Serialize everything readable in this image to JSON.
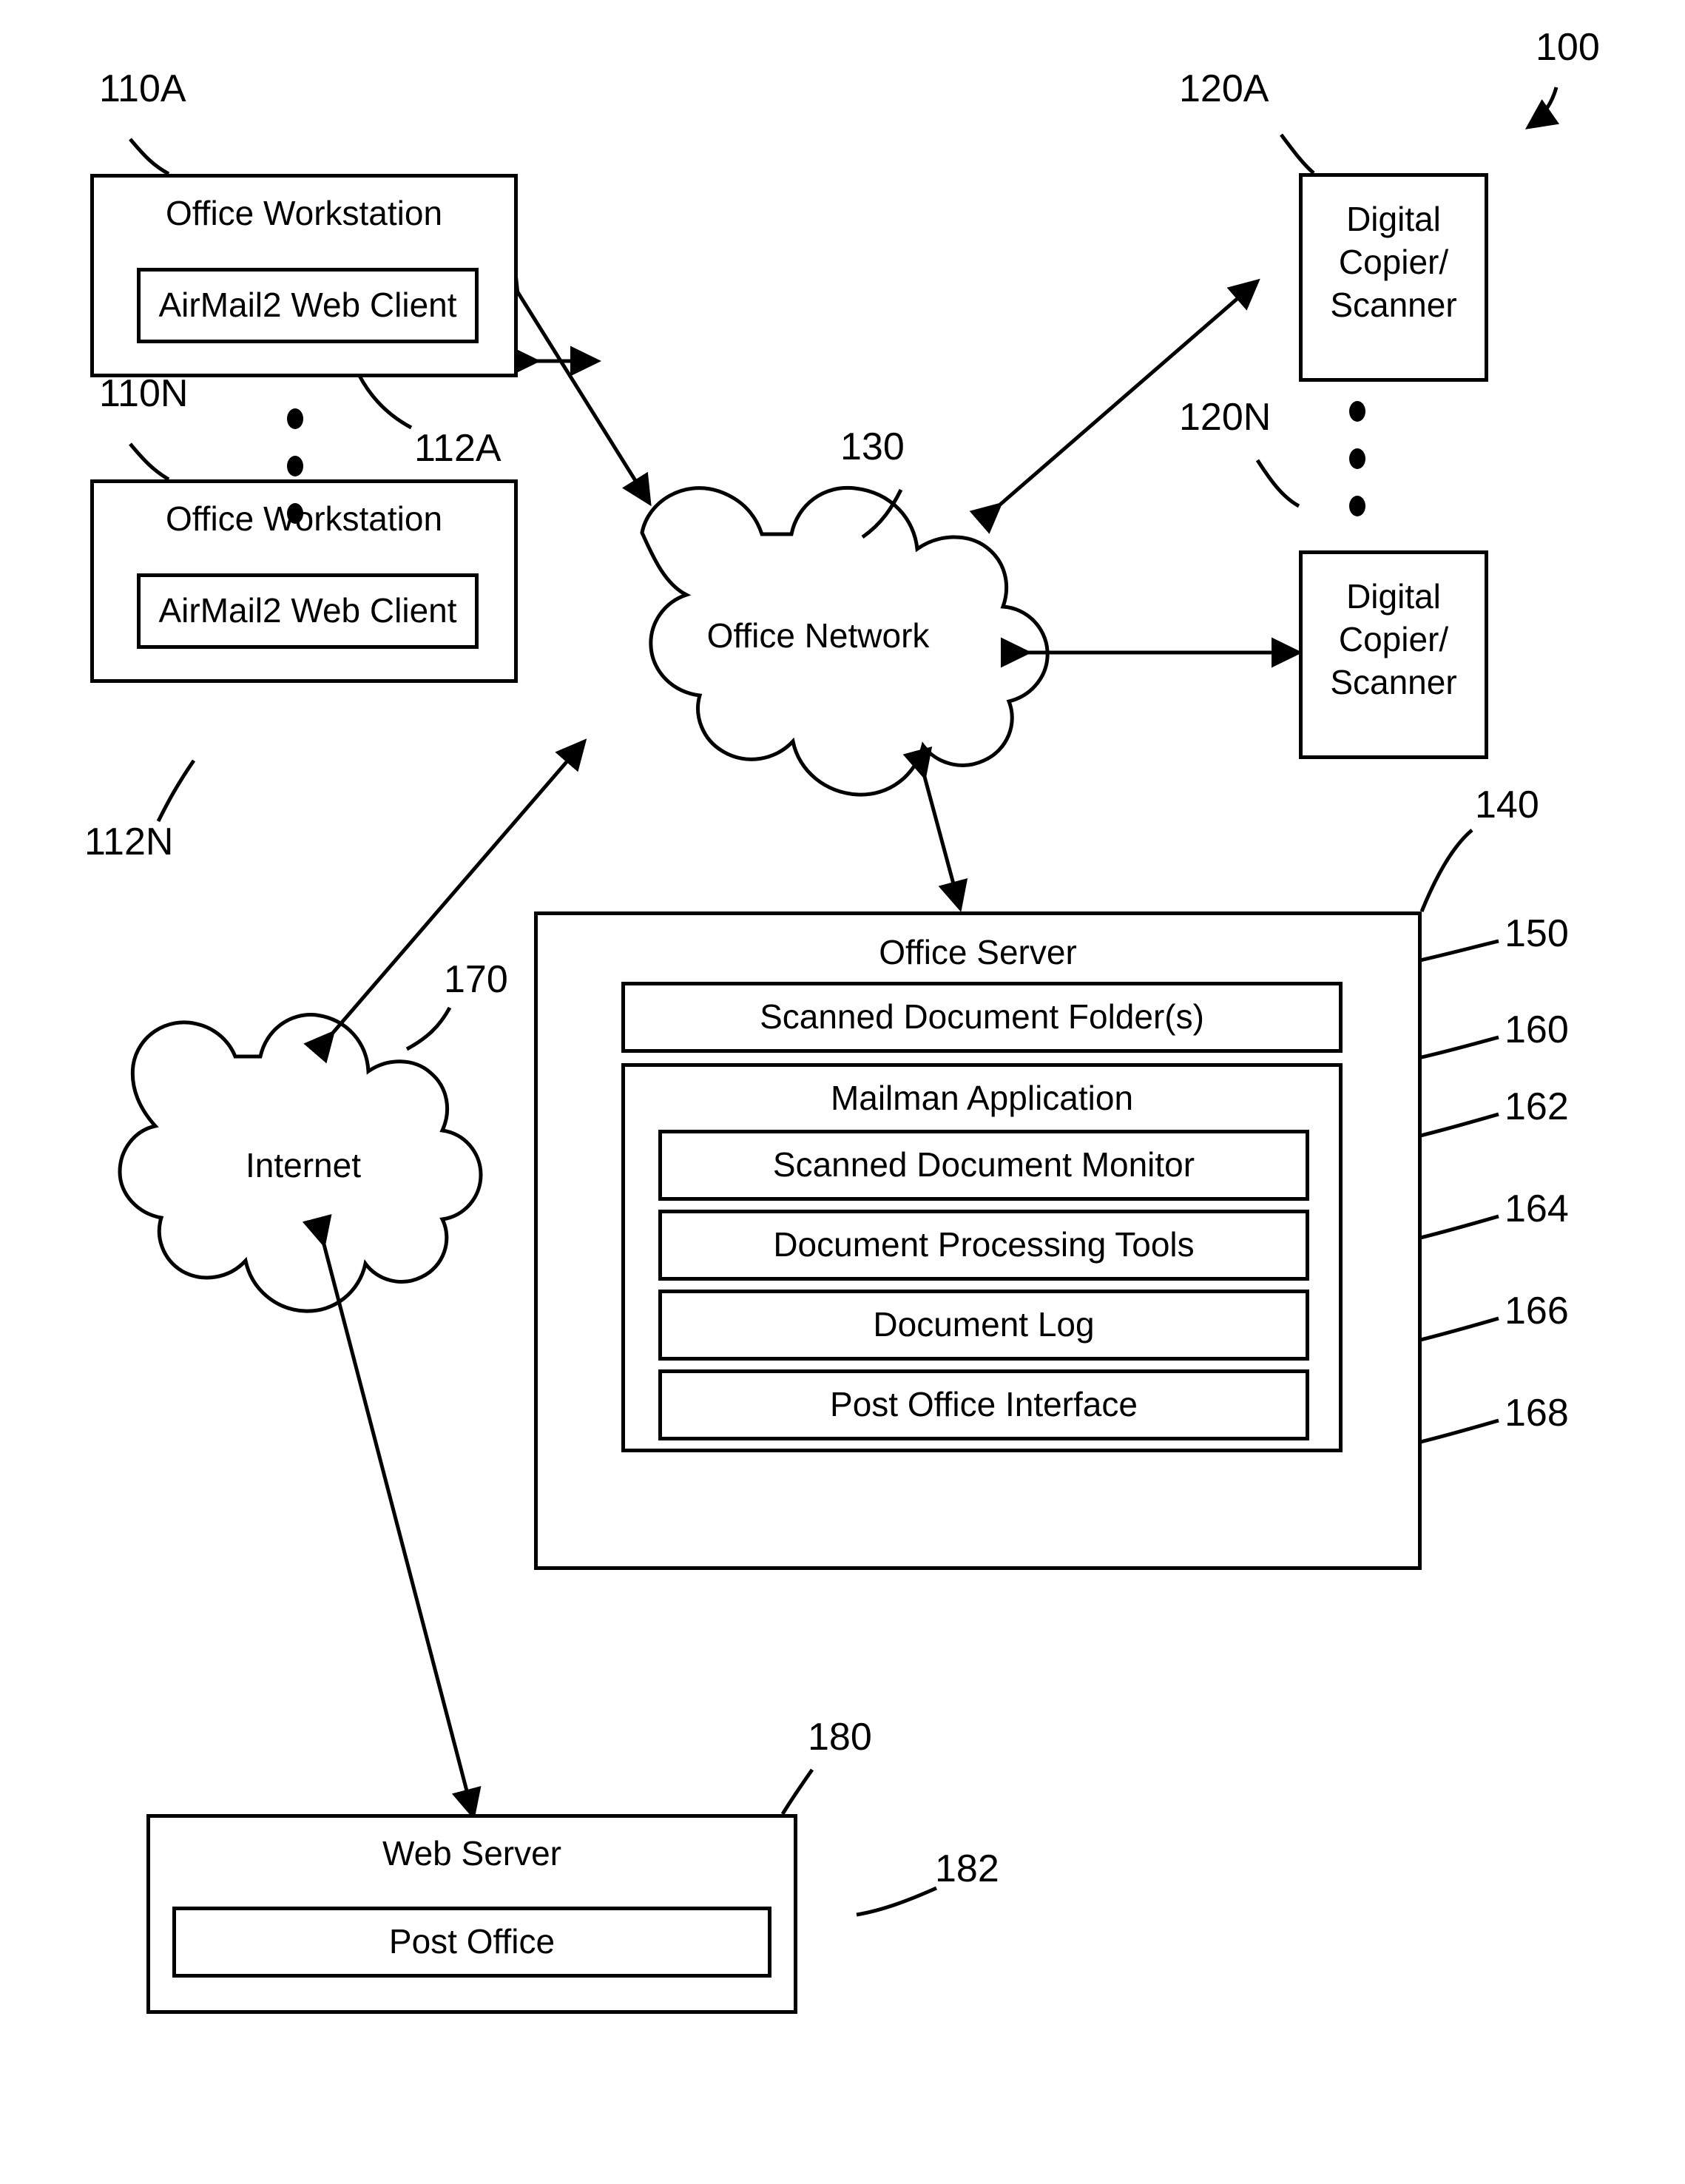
{
  "figure": {
    "system_ref": "100",
    "nodes": {
      "workstation_a": {
        "title": "Office Workstation",
        "ref": "110A",
        "client": {
          "label": "AirMail2 Web Client",
          "ref": "112A"
        }
      },
      "workstation_n": {
        "title": "Office Workstation",
        "ref": "110N",
        "client": {
          "label": "AirMail2 Web Client",
          "ref": "112N"
        }
      },
      "copier_a": {
        "line1": "Digital",
        "line2": "Copier/",
        "line3": "Scanner",
        "ref": "120A"
      },
      "copier_n": {
        "line1": "Digital",
        "line2": "Copier/",
        "line3": "Scanner",
        "ref": "120N"
      },
      "office_network": {
        "label": "Office Network",
        "ref": "130"
      },
      "internet": {
        "label": "Internet",
        "ref": "170"
      },
      "office_server": {
        "title": "Office Server",
        "ref": "140",
        "scanned_folder": {
          "label": "Scanned Document Folder(s)",
          "ref": "150"
        },
        "mailman": {
          "title": "Mailman Application",
          "ref": "160",
          "components": [
            {
              "label": "Scanned Document Monitor",
              "ref": "162"
            },
            {
              "label": "Document Processing Tools",
              "ref": "164"
            },
            {
              "label": "Document Log",
              "ref": "166"
            },
            {
              "label": "Post Office Interface",
              "ref": "168"
            }
          ]
        }
      },
      "web_server": {
        "title": "Web Server",
        "ref": "180",
        "post_office": {
          "label": "Post Office",
          "ref": "182"
        }
      }
    },
    "colors": {
      "stroke": "#000000",
      "fill": "#ffffff"
    }
  }
}
